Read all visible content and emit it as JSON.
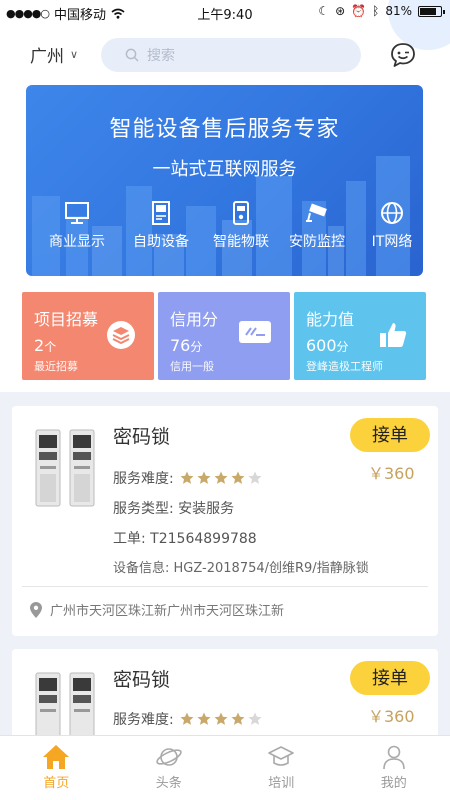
{
  "status_bar": {
    "carrier": "中国移动",
    "time": "上午9:40",
    "battery_pct": "81%",
    "battery_level": 0.81
  },
  "header": {
    "city": "广州",
    "search_placeholder": "搜索"
  },
  "banner": {
    "title": "智能设备售后服务专家",
    "subtitle": "一站式互联网服务",
    "categories": [
      {
        "label": "商业显示",
        "icon": "monitor-icon"
      },
      {
        "label": "自助设备",
        "icon": "kiosk-icon"
      },
      {
        "label": "智能物联",
        "icon": "smart-lock-icon"
      },
      {
        "label": "安防监控",
        "icon": "cctv-camera-icon"
      },
      {
        "label": "IT网络",
        "icon": "globe-icon"
      }
    ]
  },
  "stat_cards": [
    {
      "title": "项目招募",
      "value": "2",
      "unit": "个",
      "sub": "最近招募",
      "color": "#f4876f",
      "icon": "layers-icon"
    },
    {
      "title": "信用分",
      "value": "76",
      "unit": "分",
      "sub": "信用一般",
      "color": "#8f9ef0",
      "icon": "card-icon"
    },
    {
      "title": "能力值",
      "value": "600",
      "unit": "分",
      "sub": "登峰造极工程师",
      "color": "#5ec4ee",
      "icon": "thumbs-up-icon"
    }
  ],
  "orders": [
    {
      "title": "密码锁",
      "accept_label": "接单",
      "price": "￥360",
      "difficulty_label": "服务难度:",
      "difficulty_rating": 4,
      "difficulty_max": 5,
      "service_type": "服务类型:  安装服务",
      "work_order": "工单:  T21564899788",
      "device_info": "设备信息:  HGZ-2018754/创维R9/指静脉锁",
      "address": "广州市天河区珠江新广州市天河区珠江新"
    },
    {
      "title": "密码锁",
      "accept_label": "接单",
      "price": "￥360",
      "difficulty_label": "服务难度:",
      "difficulty_rating": 4,
      "difficulty_max": 5
    }
  ],
  "tabbar": {
    "tabs": [
      {
        "label": "首页",
        "icon": "home-icon",
        "active": true
      },
      {
        "label": "头条",
        "icon": "planet-icon",
        "active": false
      },
      {
        "label": "培训",
        "icon": "graduation-cap-icon",
        "active": false
      },
      {
        "label": "我的",
        "icon": "user-icon",
        "active": false
      }
    ]
  },
  "colors": {
    "accent": "#f5a623",
    "button": "#fcd23c",
    "price": "#c7a25f",
    "banner": "#3478e2",
    "star": "#c9a96a"
  }
}
